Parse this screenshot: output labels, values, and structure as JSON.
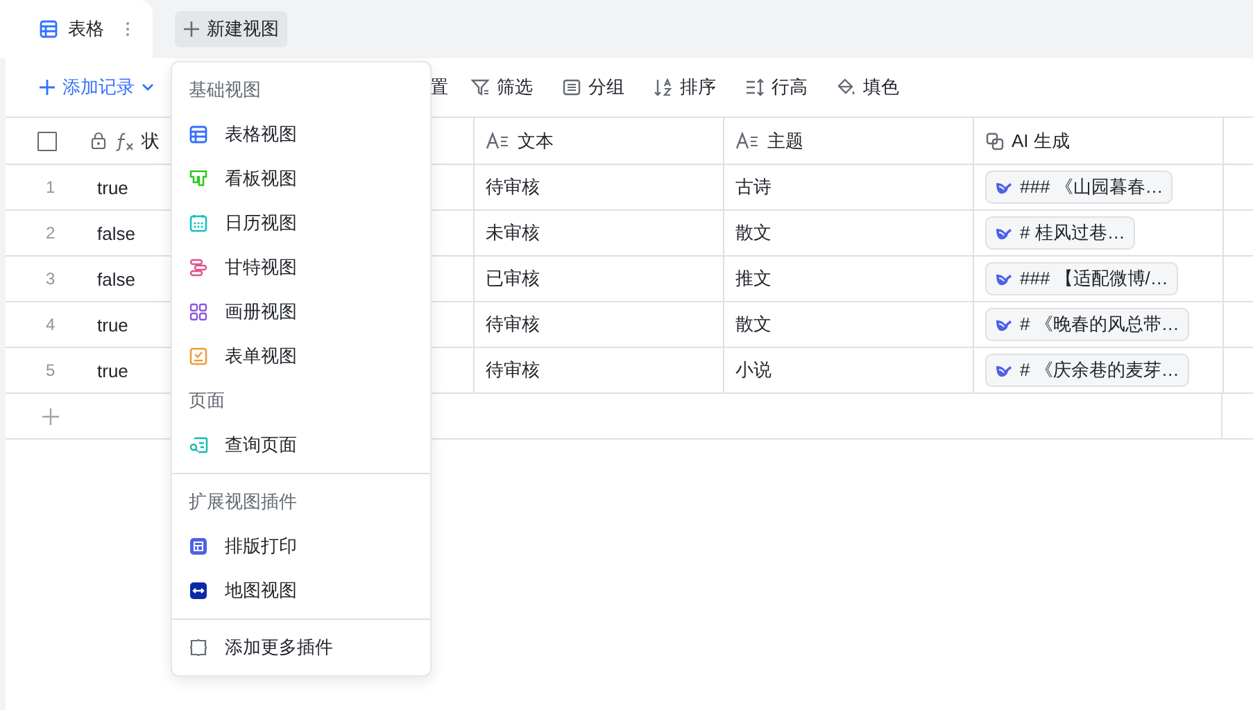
{
  "tabs": [
    {
      "label": "表格",
      "selected": true
    }
  ],
  "new_view_button": "新建视图",
  "toolbar": {
    "add_record": "添加记录",
    "items": [
      {
        "label": "置",
        "kind": "none"
      },
      {
        "label": "筛选",
        "kind": "filter"
      },
      {
        "label": "分组",
        "kind": "group"
      },
      {
        "label": "排序",
        "kind": "sort"
      },
      {
        "label": "行高",
        "kind": "height"
      },
      {
        "label": "填色",
        "kind": "fill"
      }
    ]
  },
  "table": {
    "select_all": {
      "checked": false
    },
    "columns": [
      {
        "label": "状",
        "kind": "formula"
      },
      {
        "label": "文本",
        "kind": "text"
      },
      {
        "label": "主题",
        "kind": "text"
      },
      {
        "label": "AI 生成",
        "kind": "ai"
      }
    ],
    "rows": [
      {
        "index": "1",
        "status": "true",
        "text": "待审核",
        "topic": "古诗",
        "ai": "### 《山园暮春…"
      },
      {
        "index": "2",
        "status": "false",
        "text": "未审核",
        "topic": "散文",
        "ai": "# 桂风过巷…"
      },
      {
        "index": "3",
        "status": "false",
        "text": "已审核",
        "topic": "推文",
        "ai": "### 【适配微博/…"
      },
      {
        "index": "4",
        "status": "true",
        "text": "待审核",
        "topic": "散文",
        "ai": "# 《晚春的风总带…"
      },
      {
        "index": "5",
        "status": "true",
        "text": "待审核",
        "topic": "小说",
        "ai": "# 《庆余巷的麦芽…"
      }
    ]
  },
  "menu": {
    "groups": [
      {
        "sections": [
          {
            "title": "基础视图",
            "items": [
              {
                "label": "表格视图",
                "kind": "grid",
                "color": "#3370ff"
              },
              {
                "label": "看板视图",
                "kind": "kanban",
                "color": "#34c724"
              },
              {
                "label": "日历视图",
                "kind": "calendar",
                "color": "#14c0c7"
              },
              {
                "label": "甘特视图",
                "kind": "gantt",
                "color": "#e5508a"
              },
              {
                "label": "画册视图",
                "kind": "gallery",
                "color": "#8a57d8"
              },
              {
                "label": "表单视图",
                "kind": "form",
                "color": "#f09a37"
              }
            ]
          },
          {
            "title": "页面",
            "items": [
              {
                "label": "查询页面",
                "kind": "query",
                "color": "#14b8b0"
              }
            ]
          }
        ]
      },
      {
        "sections": [
          {
            "title": "扩展视图插件",
            "items": [
              {
                "label": "排版打印",
                "kind": "print",
                "color": "#4e62e6"
              },
              {
                "label": "地图视图",
                "kind": "map",
                "color": "#0a2aa8"
              }
            ]
          }
        ]
      },
      {
        "sections": [
          {
            "items": [
              {
                "label": "添加更多插件",
                "kind": "plugin",
                "color": "#646a73"
              }
            ]
          }
        ]
      }
    ]
  }
}
